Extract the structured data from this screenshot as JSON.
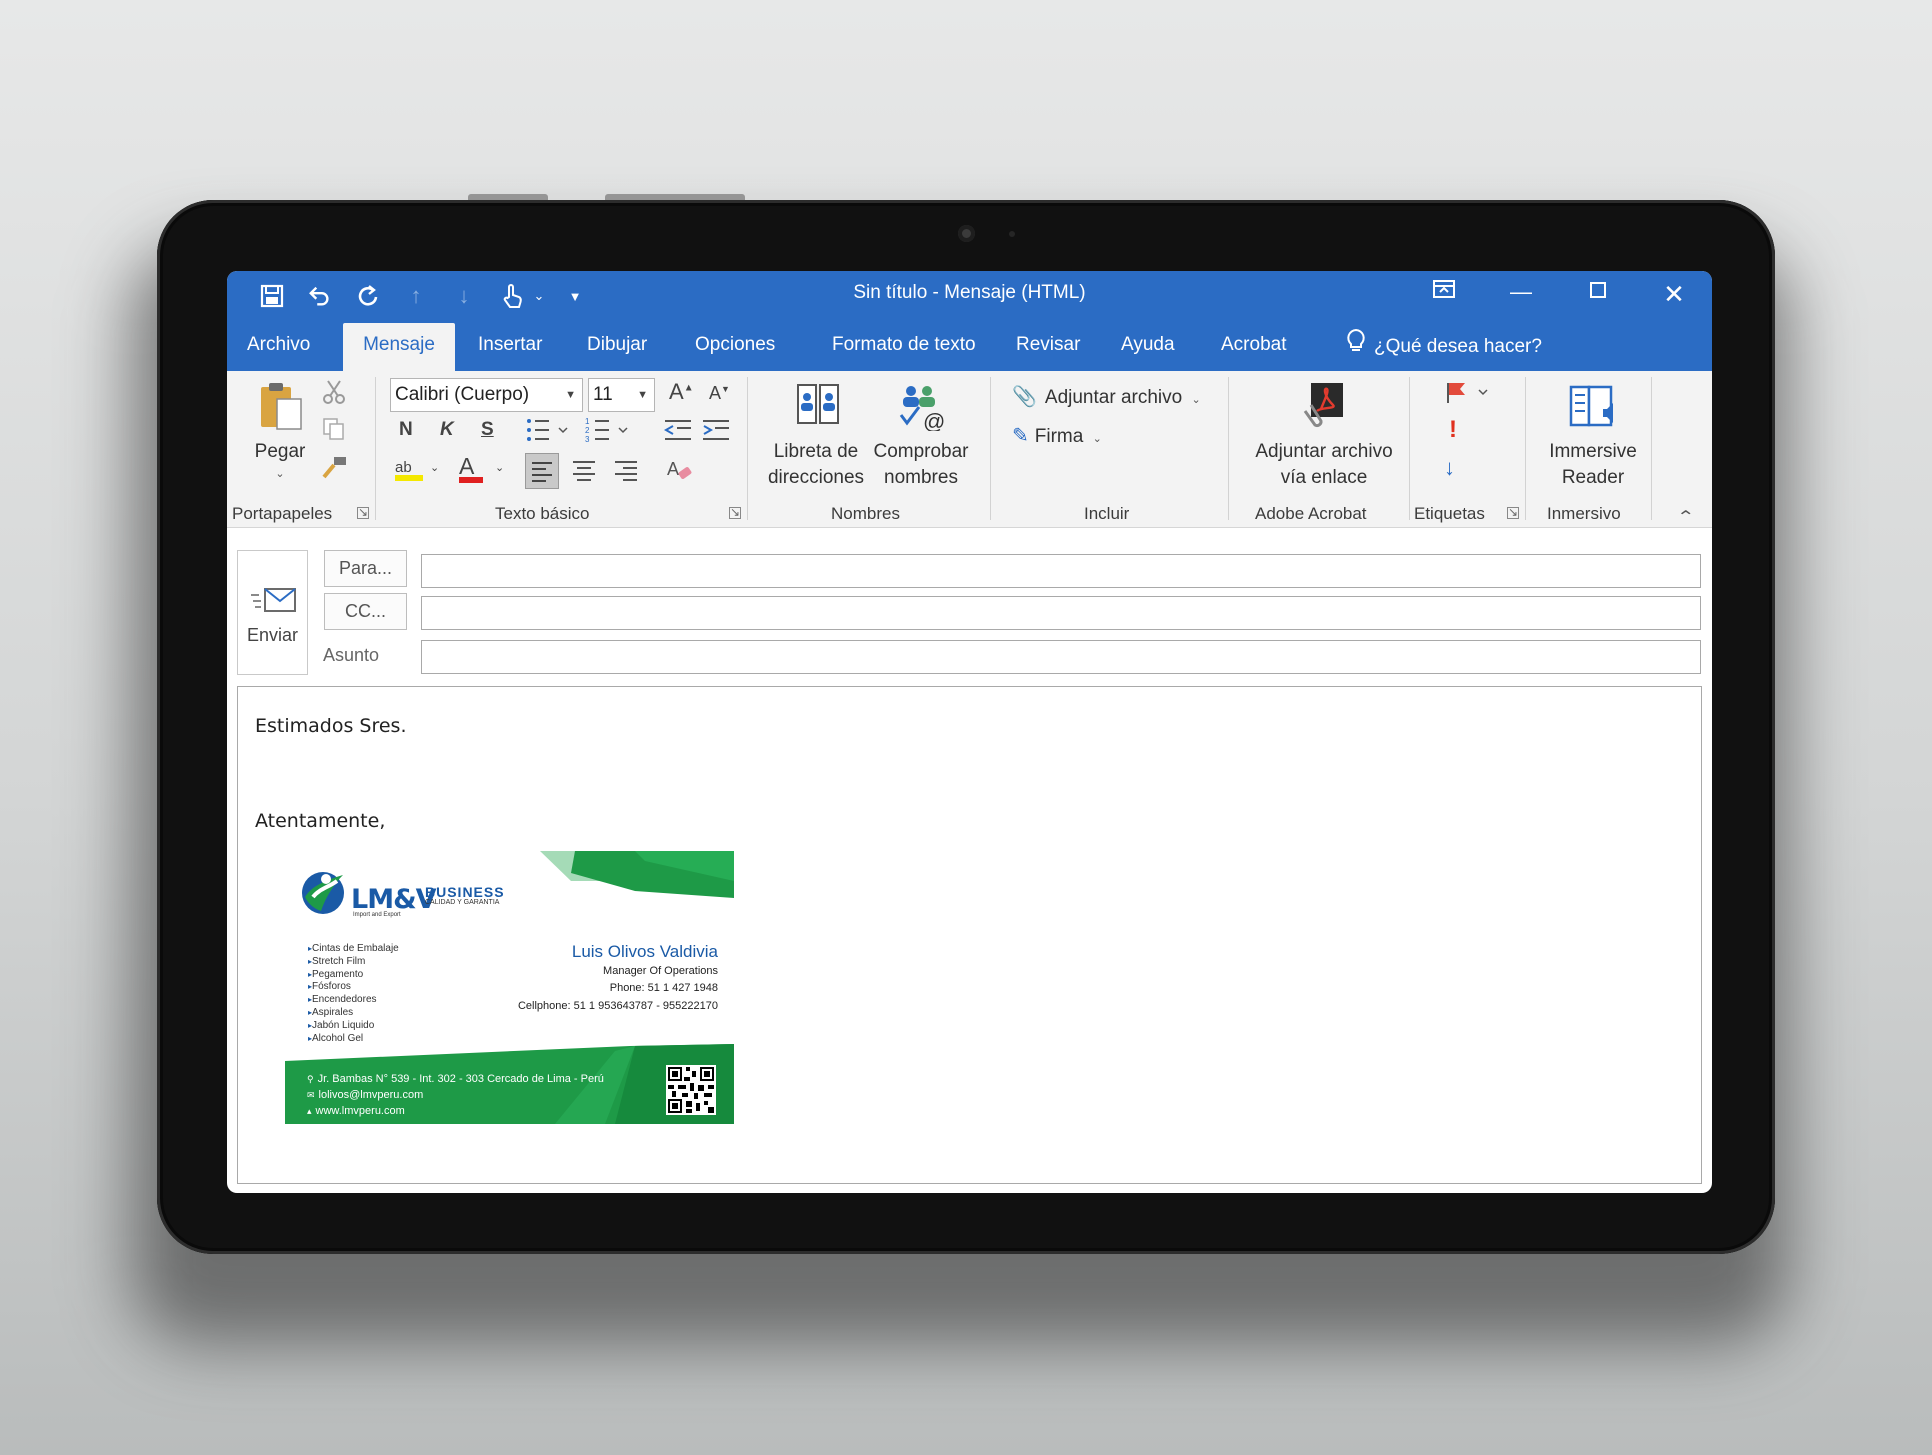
{
  "window": {
    "title": "Sin título  -  Mensaje (HTML)"
  },
  "quick_access": [
    "save-icon",
    "undo-icon",
    "redo-icon",
    "up-arrow-icon",
    "down-arrow-icon",
    "touch-mode-icon",
    "customize-icon"
  ],
  "tabs": [
    {
      "label": "Archivo"
    },
    {
      "label": "Mensaje"
    },
    {
      "label": "Insertar"
    },
    {
      "label": "Dibujar"
    },
    {
      "label": "Opciones"
    },
    {
      "label": "Formato de texto"
    },
    {
      "label": "Revisar"
    },
    {
      "label": "Ayuda"
    },
    {
      "label": "Acrobat"
    }
  ],
  "tell_me": "¿Qué desea hacer?",
  "ribbon": {
    "clipboard": {
      "paste_label": "Pegar",
      "group_label": "Portapapeles"
    },
    "basic_text": {
      "font_name": "Calibri (Cuerpo)",
      "font_size": "11",
      "bold": "N",
      "italic": "K",
      "underline": "S",
      "grow_font": "A",
      "shrink_font": "A",
      "font_color_letter": "A",
      "highlight_letters": "ab",
      "group_label": "Texto básico"
    },
    "names": {
      "address_book_line1": "Libreta de",
      "address_book_line2": "direcciones",
      "check_names_line1": "Comprobar",
      "check_names_line2": "nombres",
      "group_label": "Nombres"
    },
    "include": {
      "attach_file": "Adjuntar archivo",
      "signature": "Firma",
      "group_label": "Incluir"
    },
    "adobe": {
      "attach_link_line1": "Adjuntar archivo",
      "attach_link_line2": "vía enlace",
      "group_label": "Adobe Acrobat"
    },
    "tags": {
      "high_importance": "!",
      "group_label": "Etiquetas"
    },
    "immersive": {
      "reader_line1": "Immersive",
      "reader_line2": "Reader",
      "group_label": "Inmersivo"
    }
  },
  "header": {
    "send_label": "Enviar",
    "to_label": "Para...",
    "cc_label": "CC...",
    "subject_label": "Asunto",
    "to_value": "",
    "cc_value": "",
    "subject_value": ""
  },
  "body": {
    "greeting": "Estimados Sres.",
    "closing": "Atentamente,"
  },
  "signature_card": {
    "logo_main": "LM&V",
    "logo_business": "BUSINESS",
    "logo_tagline": "CALIDAD Y GARANTIA",
    "logo_subtitle": "Import and Export",
    "products": [
      "Cintas de Embalaje",
      "Stretch Film",
      "Pegamento",
      "Fósforos",
      "Encendedores",
      "Aspirales",
      "Jabón Liquido",
      "Alcohol Gel"
    ],
    "name": "Luis Olivos Valdivia",
    "position": "Manager Of Operations",
    "phone": "Phone: 51 1 427 1948",
    "cellphone": "Cellphone: 51 1 953643787  -  955222170",
    "address": "Jr. Bambas N° 539 - Int. 302 - 303 Cercado de Lima - Perú",
    "email": "lolivos@lmvperu.com",
    "website": "www.lmvperu.com",
    "colors": {
      "green": "#1e9a47",
      "blue": "#1a5aa6"
    }
  },
  "colors": {
    "titlebar": "#2b6cc4",
    "ribbon": "#f3f3f3"
  }
}
